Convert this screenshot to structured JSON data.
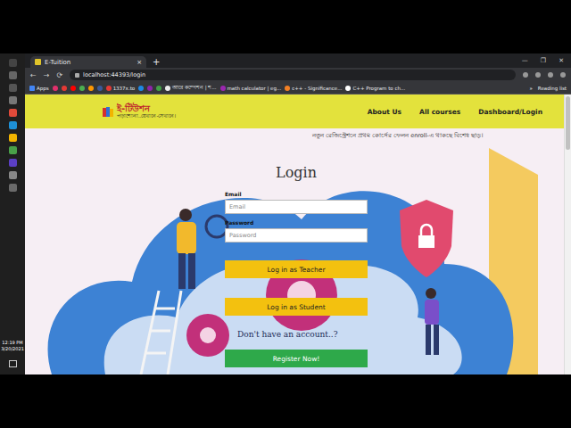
{
  "browser": {
    "tab": {
      "title": "E-Tuition",
      "close": "×"
    },
    "new_tab": "+",
    "window_controls": [
      "—",
      "❐",
      "✕"
    ],
    "url": "localhost:44393/login",
    "nav_buttons": [
      "←",
      "→",
      "⟳"
    ],
    "bookmarks_apps": "Apps",
    "bookmark_icons": [
      {
        "color": "#e1306c"
      },
      {
        "color": "#e53935"
      },
      {
        "color": "#ff0000"
      },
      {
        "color": "#4caf50"
      },
      {
        "color": "#ff9800"
      },
      {
        "color": "#3b5998"
      }
    ],
    "bookmarks": [
      {
        "label": "1337x.to",
        "color": "#e53935"
      },
      {
        "label": "",
        "color": "#1e88e5"
      },
      {
        "label": "",
        "color": "#8e24aa"
      },
      {
        "label": "",
        "color": "#43a047"
      },
      {
        "label": "আরে কম্পেশন | শ...",
        "color": "#eeeeee"
      },
      {
        "label": "math calculator | eg...",
        "color": "#9c27b0"
      },
      {
        "label": "c++ - Significance...",
        "color": "#f48024"
      },
      {
        "label": "C++ Program to ch...",
        "color": "#ffffff"
      }
    ],
    "bookmarks_more": "»",
    "reading_list": "Reading list"
  },
  "site": {
    "logo": "ই-টিউশন",
    "tagline": "পড়াশোনা..যেখানে-সেখানে।",
    "nav": [
      "About Us",
      "All courses",
      "Dashboard/Login"
    ],
    "notice": "নতুন রেজিস্ট্রেশনে প্রথম কোর্সের ফেলন enroll-এ থাকছে বিশেষ ছাড়।"
  },
  "login": {
    "title": "Login",
    "email_label": "Email",
    "email_placeholder": "Email",
    "password_label": "Password",
    "password_placeholder": "Password",
    "buttons": [
      "Log in as Teacher",
      "Log in as Student"
    ],
    "prompt": "Don't have an account..?",
    "register": "Register Now!"
  },
  "taskbar": {
    "time": "12:19 PM",
    "date": "3/20/2021"
  }
}
